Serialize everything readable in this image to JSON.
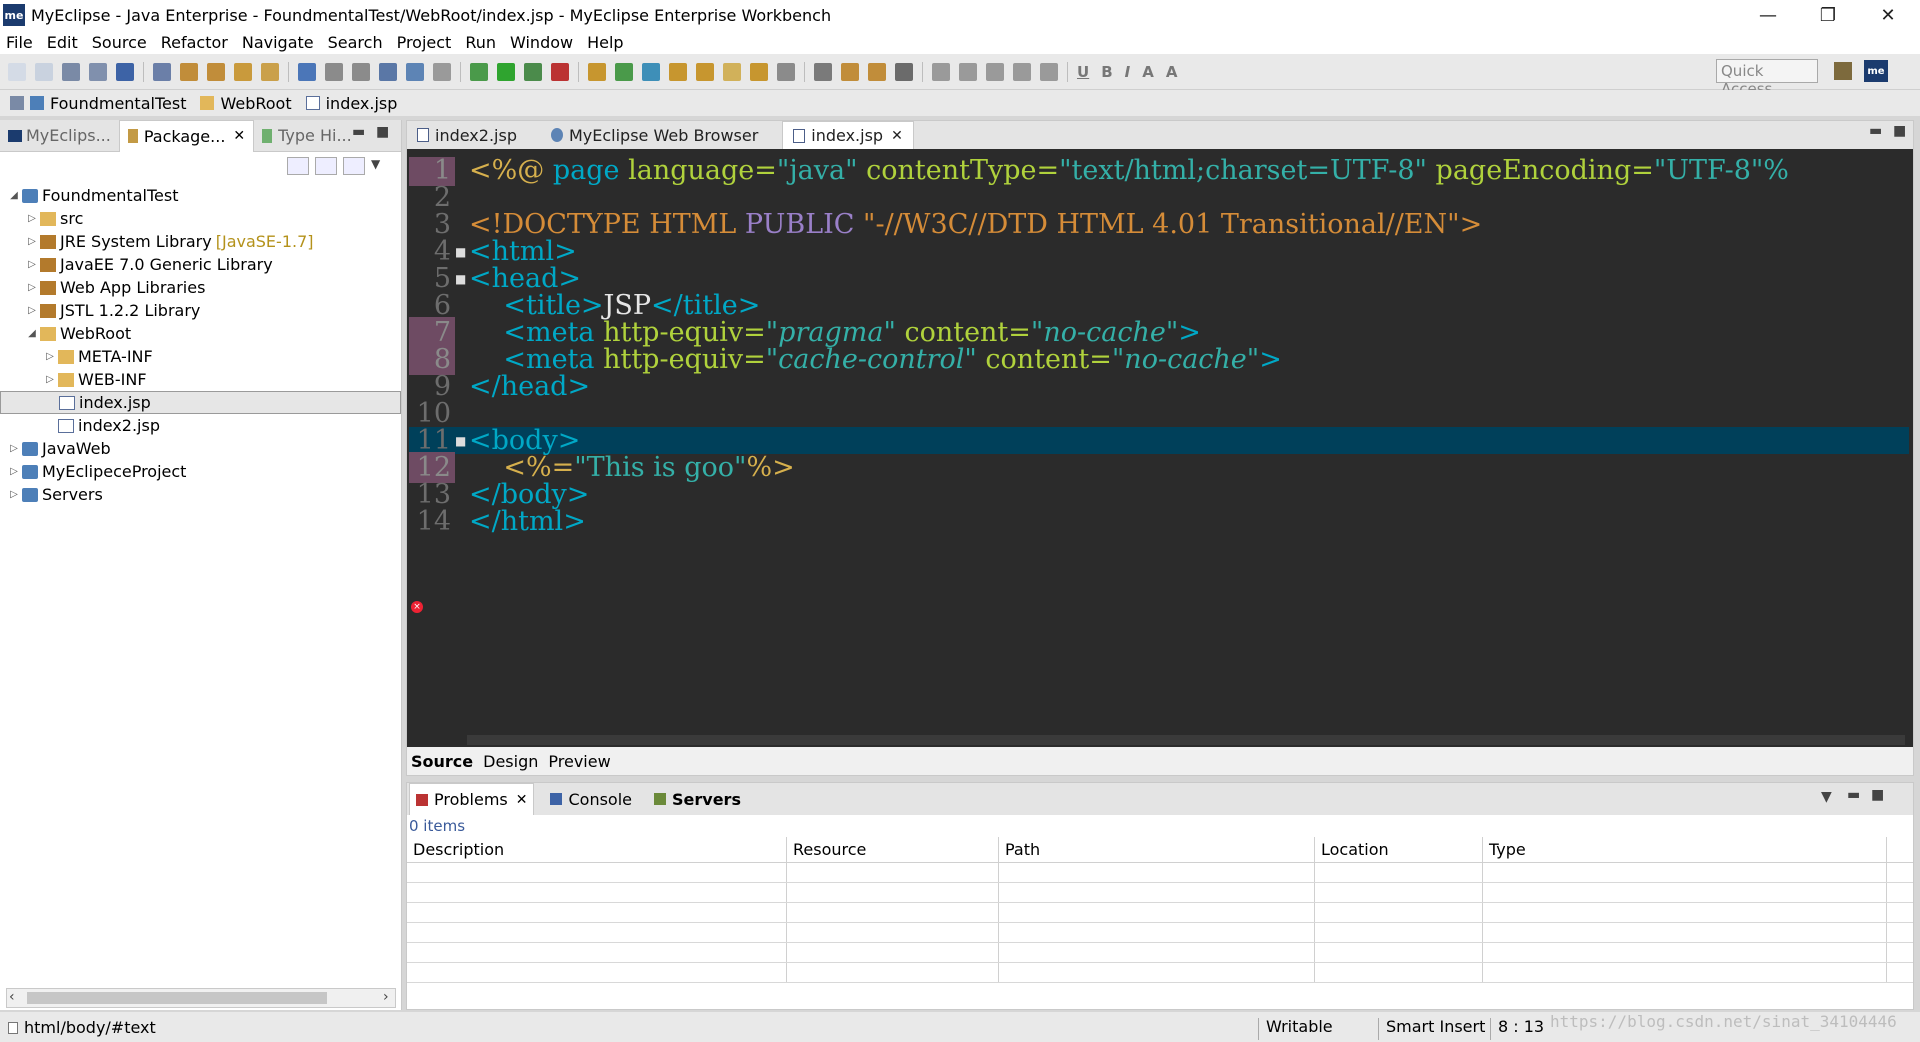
{
  "window": {
    "title": "MyEclipse - Java Enterprise - FoundmentalTest/WebRoot/index.jsp - MyEclipse Enterprise Workbench",
    "logo": "me",
    "controls": [
      "—",
      "❐",
      "✕"
    ]
  },
  "menu": [
    "File",
    "Edit",
    "Source",
    "Refactor",
    "Navigate",
    "Search",
    "Project",
    "Run",
    "Window",
    "Help"
  ],
  "toolbar": {
    "quick_access": "Quick Access",
    "format_b": "B",
    "format_i": "I",
    "format_u": "U",
    "format_a": "A",
    "right_logo": "me"
  },
  "breadcrumb": [
    {
      "label": "FoundmentalTest",
      "icon": "project-icon"
    },
    {
      "label": "WebRoot",
      "icon": "folder-icon"
    },
    {
      "label": "index.jsp",
      "icon": "jsp-file-icon"
    }
  ],
  "left_panel": {
    "tabs": [
      {
        "label": "MyEclips...",
        "icon": "myeclipse-icon"
      },
      {
        "label": "Package...",
        "icon": "package-explorer-icon",
        "close": "✕"
      },
      {
        "label": "Type Hi...",
        "icon": "type-hierarchy-icon"
      }
    ],
    "tree": [
      {
        "label": "FoundmentalTest",
        "level": 0,
        "twisty": "◢",
        "type": "proj"
      },
      {
        "label": "src",
        "level": 1,
        "twisty": "▷",
        "type": "folder"
      },
      {
        "label": "JRE System Library",
        "extra": "[JavaSE-1.7]",
        "level": 1,
        "twisty": "▷",
        "type": "lib"
      },
      {
        "label": "JavaEE 7.0 Generic Library",
        "level": 1,
        "twisty": "▷",
        "type": "lib"
      },
      {
        "label": "Web App Libraries",
        "level": 1,
        "twisty": "▷",
        "type": "lib"
      },
      {
        "label": "JSTL 1.2.2 Library",
        "level": 1,
        "twisty": "▷",
        "type": "lib"
      },
      {
        "label": "WebRoot",
        "level": 1,
        "twisty": "◢",
        "type": "folder"
      },
      {
        "label": "META-INF",
        "level": 2,
        "twisty": "▷",
        "type": "folder"
      },
      {
        "label": "WEB-INF",
        "level": 2,
        "twisty": "▷",
        "type": "folder"
      },
      {
        "label": "index.jsp",
        "level": 2,
        "twisty": "",
        "type": "file",
        "selected": true
      },
      {
        "label": "index2.jsp",
        "level": 2,
        "twisty": "",
        "type": "file"
      },
      {
        "label": "JavaWeb",
        "level": 0,
        "twisty": "▷",
        "type": "proj"
      },
      {
        "label": "MyEclipeceProject",
        "level": 0,
        "twisty": "▷",
        "type": "proj"
      },
      {
        "label": "Servers",
        "level": 0,
        "twisty": "▷",
        "type": "proj"
      }
    ]
  },
  "editor": {
    "tabs": [
      {
        "label": "index2.jsp",
        "active": false
      },
      {
        "label": "MyEclipse Web Browser",
        "active": false
      },
      {
        "label": "index.jsp",
        "active": true,
        "close": "✕"
      }
    ],
    "lines": [
      {
        "n": "1",
        "tokens": [
          [
            "jsp",
            "<%@ "
          ],
          [
            "tag",
            "page "
          ],
          [
            "attr",
            "language="
          ],
          [
            "str",
            "\"java\" "
          ],
          [
            "attr",
            "contentType="
          ],
          [
            "str",
            "\"text/html;charset=UTF-8\" "
          ],
          [
            "attr",
            "pageEncoding="
          ],
          [
            "str",
            "\"UTF-8\"%"
          ]
        ]
      },
      {
        "n": "2",
        "tokens": []
      },
      {
        "n": "3",
        "tokens": [
          [
            "doctype",
            "<!DOCTYPE HTML "
          ],
          [
            "public",
            "PUBLIC "
          ],
          [
            "doctype",
            "\"-//W3C//DTD HTML 4.01 Transitional//EN\">"
          ]
        ]
      },
      {
        "n": "4",
        "fold": true,
        "tokens": [
          [
            "tag",
            "<html>"
          ]
        ]
      },
      {
        "n": "5",
        "fold": true,
        "tokens": [
          [
            "tag",
            "<head>"
          ]
        ]
      },
      {
        "n": "6",
        "tokens": [
          [
            "txt",
            "    "
          ],
          [
            "tag",
            "<title>"
          ],
          [
            "txt",
            "JSP"
          ],
          [
            "tag",
            "</title>"
          ]
        ]
      },
      {
        "n": "7",
        "tokens": [
          [
            "txt",
            "    "
          ],
          [
            "tag",
            "<meta "
          ],
          [
            "attr",
            "http-equiv="
          ],
          [
            "stri",
            "\"pragma\" "
          ],
          [
            "attr",
            "content="
          ],
          [
            "stri",
            "\"no-cache\""
          ],
          [
            "tag",
            ">"
          ]
        ]
      },
      {
        "n": "8",
        "tokens": [
          [
            "txt",
            "    "
          ],
          [
            "tag",
            "<meta "
          ],
          [
            "attr",
            "http-equiv="
          ],
          [
            "stri",
            "\"cache-control\" "
          ],
          [
            "attr",
            "content="
          ],
          [
            "stri",
            "\"no-cache\""
          ],
          [
            "tag",
            ">"
          ]
        ]
      },
      {
        "n": "9",
        "tokens": [
          [
            "tag",
            "</head>"
          ]
        ]
      },
      {
        "n": "10",
        "tokens": []
      },
      {
        "n": "11",
        "fold": true,
        "current": true,
        "tokens": [
          [
            "tag",
            "<body>"
          ]
        ]
      },
      {
        "n": "12",
        "tokens": [
          [
            "txt",
            "    "
          ],
          [
            "jsp",
            "<%="
          ],
          [
            "str",
            "\"This is goo\""
          ],
          [
            "jsp",
            "%>"
          ]
        ]
      },
      {
        "n": "13",
        "tokens": [
          [
            "tag",
            "</body>"
          ]
        ]
      },
      {
        "n": "14",
        "error": true,
        "tokens": [
          [
            "tag",
            "</html>"
          ]
        ]
      }
    ],
    "bottom_tabs": [
      "Source",
      "Design",
      "Preview"
    ],
    "error_marker": "×"
  },
  "problems": {
    "tabs": [
      {
        "label": "Problems",
        "close": "✕"
      },
      {
        "label": "Console"
      },
      {
        "label": "Servers"
      }
    ],
    "count": "0 items",
    "columns": [
      "Description",
      "Resource",
      "Path",
      "Location",
      "Type"
    ]
  },
  "status": {
    "path": "html/body/#text",
    "writable": "Writable",
    "insert_mode": "Smart Insert",
    "position": "8 : 13",
    "watermark": "https://blog.csdn.net/sinat_34104446"
  }
}
